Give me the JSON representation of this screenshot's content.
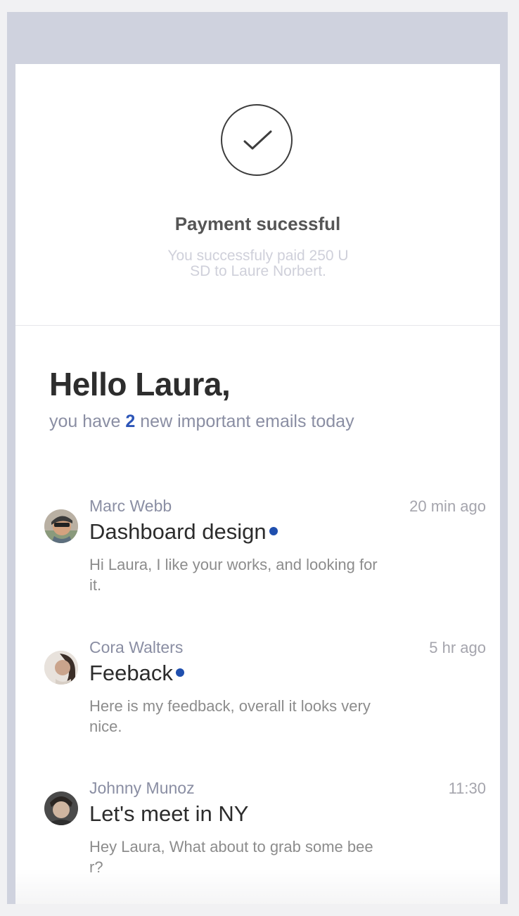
{
  "payment": {
    "title": "Payment sucessful",
    "message": "You successfuly paid 250 USD to Laure Norbert."
  },
  "greeting": {
    "title": "Hello Laura,",
    "prefix": "you have ",
    "count": "2",
    "suffix": " new important emails today"
  },
  "emails": [
    {
      "sender": "Marc Webb",
      "time": "20 min ago",
      "subject": "Dashboard design",
      "unread": true,
      "preview": "Hi Laura, I like your works, and looking for it."
    },
    {
      "sender": "Cora Walters",
      "time": "5 hr ago",
      "subject": "Feeback",
      "unread": true,
      "preview": "Here is my feedback, overall it looks very nice."
    },
    {
      "sender": "Johnny Munoz",
      "time": "11:30",
      "subject": "Let's meet in NY",
      "unread": false,
      "preview": "Hey Laura, What about to grab some beer?"
    }
  ],
  "colors": {
    "frame": "#cfd2de",
    "accent": "#2c55b7",
    "unread_dot": "#1f4fae"
  }
}
